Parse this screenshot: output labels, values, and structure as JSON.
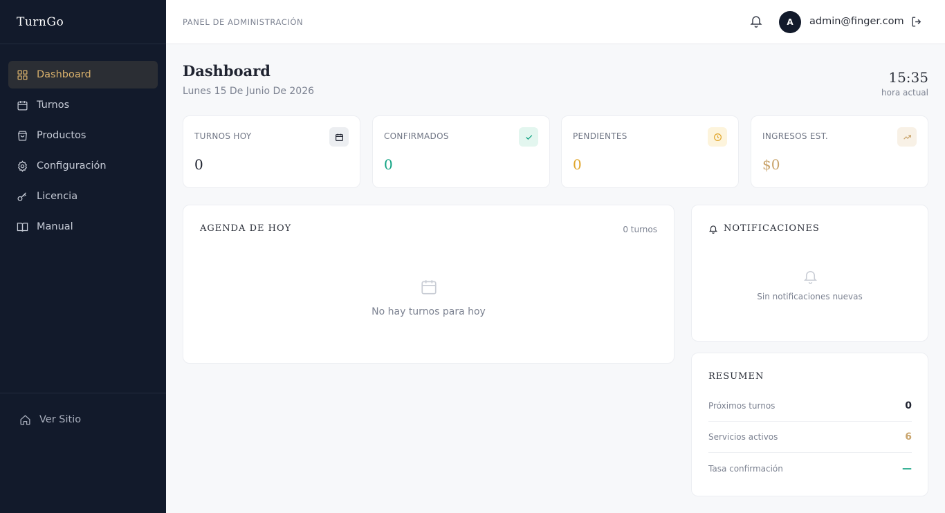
{
  "app": {
    "brand": "TurnGo"
  },
  "sidebar": {
    "items": [
      {
        "label": "Dashboard",
        "icon": "grid-icon",
        "active": true
      },
      {
        "label": "Turnos",
        "icon": "calendar-icon"
      },
      {
        "label": "Productos",
        "icon": "shopping-bag-icon"
      },
      {
        "label": "Configuración",
        "icon": "gear-icon"
      },
      {
        "label": "Licencia",
        "icon": "key-icon"
      },
      {
        "label": "Manual",
        "icon": "book-icon"
      }
    ],
    "footer": {
      "label": "Ver Sitio",
      "icon": "home-icon"
    }
  },
  "header": {
    "title": "PANEL DE ADMINISTRACIÓN",
    "avatar_initial": "A",
    "user_email": "admin@finger.com",
    "icons": [
      "bell-icon",
      "logout-icon"
    ]
  },
  "page": {
    "title": "Dashboard",
    "date": "Lunes 15 De Junio De 2026",
    "time": "15:35",
    "time_label": "hora actual"
  },
  "stats": [
    {
      "label": "TURNOS HOY",
      "value": "0",
      "icon": "calendar-icon",
      "color": "#1f2330",
      "badge_bg": "#eceef1",
      "badge_color": "#1f2330"
    },
    {
      "label": "CONFIRMADOS",
      "value": "0",
      "icon": "check-icon",
      "color": "#12a383",
      "badge_bg": "#e3f6ef",
      "badge_color": "#12a383"
    },
    {
      "label": "PENDIENTES",
      "value": "0",
      "icon": "clock-icon",
      "color": "#e0a52a",
      "badge_bg": "#fdf4dc",
      "badge_color": "#e0a52a"
    },
    {
      "label": "INGRESOS EST.",
      "value": "$0",
      "icon": "trending-up-icon",
      "color": "#c9a46c",
      "badge_bg": "#f8f1e6",
      "badge_color": "#c9a46c"
    }
  ],
  "agenda": {
    "title": "AGENDA DE HOY",
    "count": "0 turnos",
    "empty_text": "No hay turnos para hoy"
  },
  "notifications": {
    "title": "NOTIFICACIONES",
    "empty_text": "Sin notificaciones nuevas"
  },
  "summary": {
    "title": "RESUMEN",
    "rows": [
      {
        "label": "Próximos turnos",
        "value": "0",
        "color": "#1f2330"
      },
      {
        "label": "Servicios activos",
        "value": "6",
        "color": "#c9a46c"
      },
      {
        "label": "Tasa confirmación",
        "value": "—",
        "color": "#12a383"
      }
    ]
  }
}
